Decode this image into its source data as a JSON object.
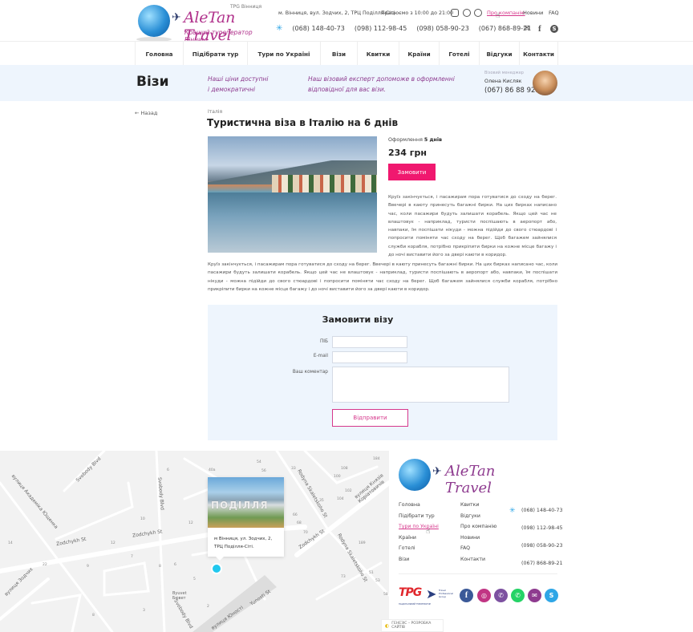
{
  "header": {
    "logo": {
      "brand": "AleTan Travel",
      "tagline": "Кращий туроператор Вінниці",
      "badge": "TPG Вінниця"
    },
    "address": "м. Вінниця, вул. Зодчих, 2, ТРЦ Поділля-Сіті",
    "hours": "Працюємо з 10:00 до 21:00",
    "social_icons": [
      "instagram-icon",
      "viber-icon",
      "whatsapp-icon"
    ],
    "top_links": [
      {
        "label": "Про компанію",
        "active": true
      },
      {
        "label": "Новини",
        "active": false
      },
      {
        "label": "FAQ",
        "active": false
      }
    ],
    "phones": [
      "(068) 148-40-73",
      "(098) 112-98-45",
      "(098) 058-90-23",
      "(067) 868-89-21"
    ],
    "contact_icons": [
      "mail-icon",
      "facebook-icon",
      "skype-icon"
    ]
  },
  "nav": {
    "items": [
      "Головна",
      "Підібрати тур",
      "Тури по Україні",
      "Візи",
      "Квитки",
      "Країни",
      "Готелі",
      "Відгуки",
      "Контакти"
    ]
  },
  "banner": {
    "title": "Візи",
    "tagline1_l1": "Наші ціни доступні",
    "tagline1_l2": "і демократичні",
    "tagline2_l1": "Наш візовий експерт допоможе в оформленні",
    "tagline2_l2": "відповідної для вас візи.",
    "manager_role": "Візовий менеджер",
    "manager_name": "Олена Кисляк",
    "manager_phone": "(067) 86 88 921"
  },
  "content": {
    "back_label": "Назад",
    "breadcrumb": "Італія",
    "title": "Туристична віза в Італію на 6 днів",
    "duration_label": "Оформлення",
    "duration_value": "5 днів",
    "price": "234 грн",
    "order_button": "Замовити",
    "description_short": "Круїз закінчується, і пасажирам пора готуватися до сходу на берег. Ввечері в каюту принесуть багажні бирки. На цих бирках написано час, коли пасажири будуть залишати корабель. Якщо цей час не влаштовує - наприклад, туристи поспішають в аеропорт або, навпаки, їм поспішати нікуди - можна підійди до свого стюардові і попросити поміняти час сходу на берег. Щоб багажем зайнялися служби корабля, потрібно прикріпити бирки на кожне місце багажу і до ночі виставити його за двері каюти в коридор.",
    "description_full": "Круїз закінчується, і пасажирам пора готуватися до сходу на берег. Ввечері в каюту принесуть багажні бирки. На цих бирках написано час, коли пасажири будуть залишати корабель. Якщо цей час не влаштовує - наприклад, туристи поспішають в аеропорт або, навпаки, їм поспішати нікуди - можна підійди до свого стюардові і попросити поміняти час сходу на берег. Щоб багажем зайнялися служби корабля, потрібно прикріпити бирки на кожне місце багажу і до ночі виставити його за двері каюти в коридор."
  },
  "form": {
    "title": "Замовити візу",
    "name_label": "ПІБ",
    "name_value": "",
    "email_label": "E-mail",
    "email_value": "",
    "comment_label": "Ваш коментар",
    "comment_value": "",
    "submit": "Відправити"
  },
  "map": {
    "popup_text": "м Вінниця, ул. Зодчих, 2, ТРЦ Поділля-Сіті.",
    "popup_sign": "ПОДІЛЛЯ",
    "street_labels": [
      "Zodchykh St",
      "Zodchykh St",
      "Zodchykh St",
      "Svobody Blvd",
      "Svobody Blvd",
      "Svobody Blvd",
      "Rodyna Skaletskoho St",
      "Rodyna Skaletskoho St",
      "вулиця Князів Коріатовичів",
      "вулиця Академіка Ющенка",
      "вулиця Зодчих",
      "вулиця Юності",
      "Yunosti St",
      "Byuvet Бювет"
    ],
    "building_numbers": [
      "40а",
      "54",
      "56",
      "33",
      "6",
      "10",
      "12",
      "14",
      "12",
      "7",
      "9",
      "8",
      "6",
      "5",
      "2",
      "3",
      "8",
      "108",
      "100",
      "102",
      "104",
      "35",
      "184",
      "70",
      "189",
      "73",
      "51",
      "53",
      "58",
      "22",
      "66",
      "68"
    ],
    "pin_color": "#21c8ee"
  },
  "footer": {
    "brand": "AleTan Travel",
    "col1": [
      {
        "label": "Головна",
        "active": false
      },
      {
        "label": "Підібрати тур",
        "active": false
      },
      {
        "label": "Тури по Україні",
        "active": true
      },
      {
        "label": "Країни",
        "active": false
      },
      {
        "label": "Готелі",
        "active": false
      },
      {
        "label": "Візи",
        "active": false
      }
    ],
    "col2": [
      {
        "label": "Квитки"
      },
      {
        "label": "Відгуки"
      },
      {
        "label": "Про компанію"
      },
      {
        "label": "Новини"
      },
      {
        "label": "FAQ"
      },
      {
        "label": "Контакти"
      }
    ],
    "phones": [
      "(068) 148-40-73",
      "(098) 112-98-45",
      "(098) 058-90-23",
      "(067) 868-89-21"
    ],
    "partner": {
      "logo": "TPG",
      "line1": "Travel",
      "line2": "Professional",
      "line3": "Group",
      "caption": "НАЦІОНАЛЬНИЙ ТУРОПЕРАТОР"
    },
    "social": [
      {
        "name": "facebook-icon",
        "glyph": "f",
        "color": "#3b5998"
      },
      {
        "name": "instagram-icon",
        "glyph": "◎",
        "color": "#c13584"
      },
      {
        "name": "viber-icon",
        "glyph": "✆",
        "color": "#7d51a0"
      },
      {
        "name": "whatsapp-icon",
        "glyph": "✆",
        "color": "#25d366"
      },
      {
        "name": "mail-icon",
        "glyph": "✉",
        "color": "#8e3b8f"
      },
      {
        "name": "skype-icon",
        "glyph": "S",
        "color": "#2fa6e6"
      }
    ],
    "developer": "ГЕНЕЗІС – РОЗРОБКА САЙТІВ"
  },
  "colors": {
    "accent": "#f0186f",
    "brand_purple": "#8e3b8f",
    "link_pink": "#d6388c",
    "banner_bg": "#eef5fd"
  }
}
